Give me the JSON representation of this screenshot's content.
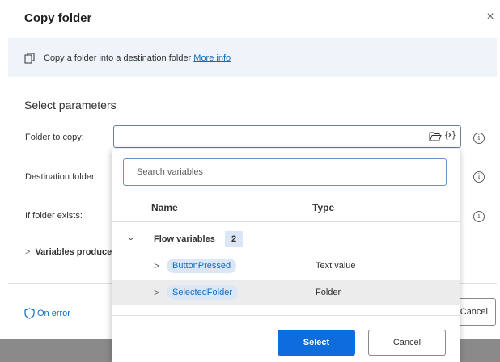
{
  "dialog": {
    "title": "Copy folder",
    "close_glyph": "×"
  },
  "banner": {
    "icon": "copy-icon",
    "text": "Copy a folder into a destination folder ",
    "link": "More info"
  },
  "parameters": {
    "section_title": "Select parameters",
    "folder_to_copy_label": "Folder to copy:",
    "folder_to_copy_value": "",
    "destination_folder_label": "Destination folder:",
    "if_folder_exists_label": "If folder exists:",
    "variables_produced_label": "Variables produced",
    "fx_label": "{x}",
    "info_glyph": "i"
  },
  "footer": {
    "on_error_label": "On error",
    "cancel_label": "Cancel"
  },
  "variables_popup": {
    "search_placeholder": "Search variables",
    "columns": {
      "name": "Name",
      "type": "Type"
    },
    "group": {
      "label": "Flow variables",
      "count": "2"
    },
    "rows": [
      {
        "name": "ButtonPressed",
        "type": "Text value",
        "selected": false
      },
      {
        "name": "SelectedFolder",
        "type": "Folder",
        "selected": true
      }
    ],
    "select_label": "Select",
    "cancel_label": "Cancel"
  },
  "colors": {
    "accent": "#0f6cdc",
    "link": "#0f6cbd",
    "banner_bg": "#eff4fa",
    "pill_bg": "#dbe6f7",
    "selected_row_bg": "#ececec"
  }
}
